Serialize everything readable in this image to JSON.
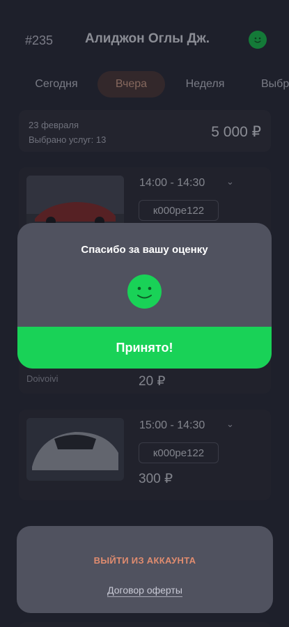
{
  "header": {
    "order_id": "#235",
    "driver_name": "Алиджон Оглы Дж.",
    "avatar_icon": "smiley-icon"
  },
  "tabs": [
    {
      "label": "Сегодня",
      "active": false
    },
    {
      "label": "Вчера",
      "active": true
    },
    {
      "label": "Неделя",
      "active": false
    },
    {
      "label": "Выбр",
      "active": false
    }
  ],
  "summary": {
    "date": "23 февраля",
    "count_label": "Выбрано услуг: 13",
    "total": "5 000 ₽"
  },
  "orders": [
    {
      "time": "14:00 - 14:30",
      "plate": "к000ре122",
      "price": "",
      "service": ""
    },
    {
      "time": "",
      "plate": "",
      "price": "20 ₽",
      "service": "Doivoivi"
    },
    {
      "time": "15:00 - 14:30",
      "plate": "к000ре122",
      "price": "300 ₽",
      "service": ""
    }
  ],
  "modal": {
    "title": "Спасибо за вашу оценку",
    "icon": "smiley-icon",
    "accept_label": "Принято!"
  },
  "account": {
    "logout_label": "ВЫЙТИ ИЗ АККАУНТА",
    "offer_label": "Договор оферты"
  },
  "colors": {
    "accent_green": "#19d257",
    "logout": "#e08c6f",
    "background": "#2a2b39",
    "sheet": "#50525f"
  }
}
